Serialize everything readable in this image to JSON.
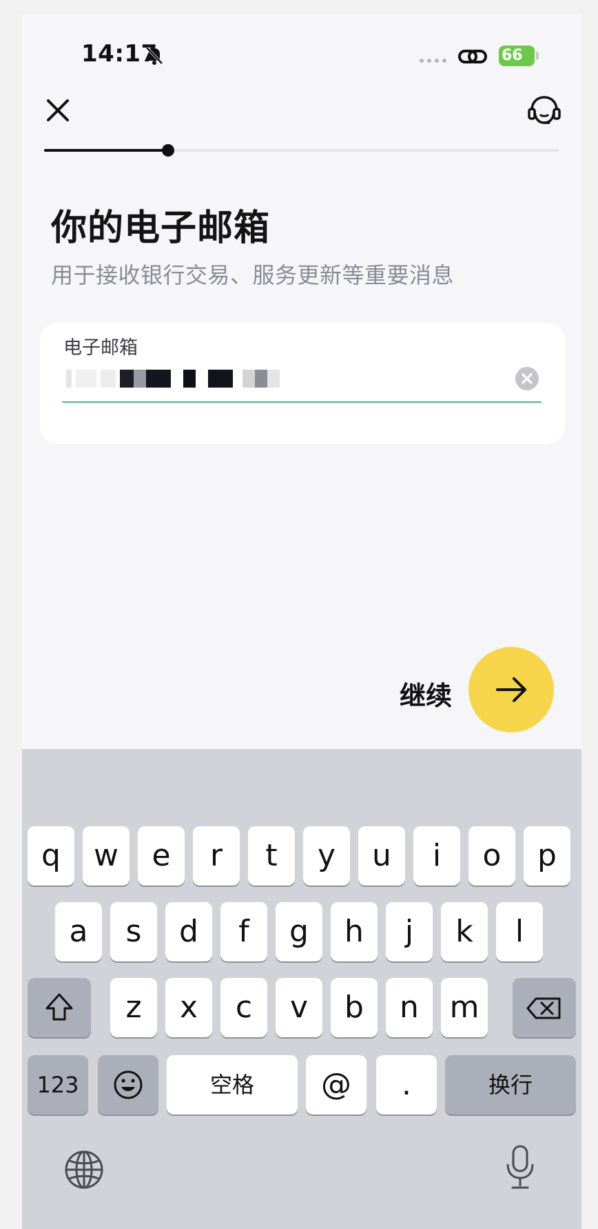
{
  "status_bar": {
    "time": "14:17",
    "battery": "66"
  },
  "progress": {
    "fraction": 0.24
  },
  "page": {
    "title": "你的电子邮箱",
    "subtitle": "用于接收银行交易、服务更新等重要消息"
  },
  "email_field": {
    "label": "电子邮箱",
    "value": ""
  },
  "continue": {
    "label": "继续"
  },
  "keyboard": {
    "row1": [
      "q",
      "w",
      "e",
      "r",
      "t",
      "y",
      "u",
      "i",
      "o",
      "p"
    ],
    "row2": [
      "a",
      "s",
      "d",
      "f",
      "g",
      "h",
      "j",
      "k",
      "l"
    ],
    "row3": [
      "z",
      "x",
      "c",
      "v",
      "b",
      "n",
      "m"
    ],
    "numbers_key": "123",
    "space_key": "空格",
    "at_key": "@",
    "dot_key": ".",
    "return_key": "换行"
  },
  "colors": {
    "accent": "#f7d54a",
    "field_underline": "#3fb8a0",
    "battery": "#6cc94a"
  },
  "icons": [
    "bell-off-icon",
    "link-icon",
    "close-icon",
    "headset-icon",
    "clear-icon",
    "arrow-right-icon",
    "shift-icon",
    "backspace-icon",
    "emoji-icon",
    "globe-icon",
    "microphone-icon"
  ]
}
